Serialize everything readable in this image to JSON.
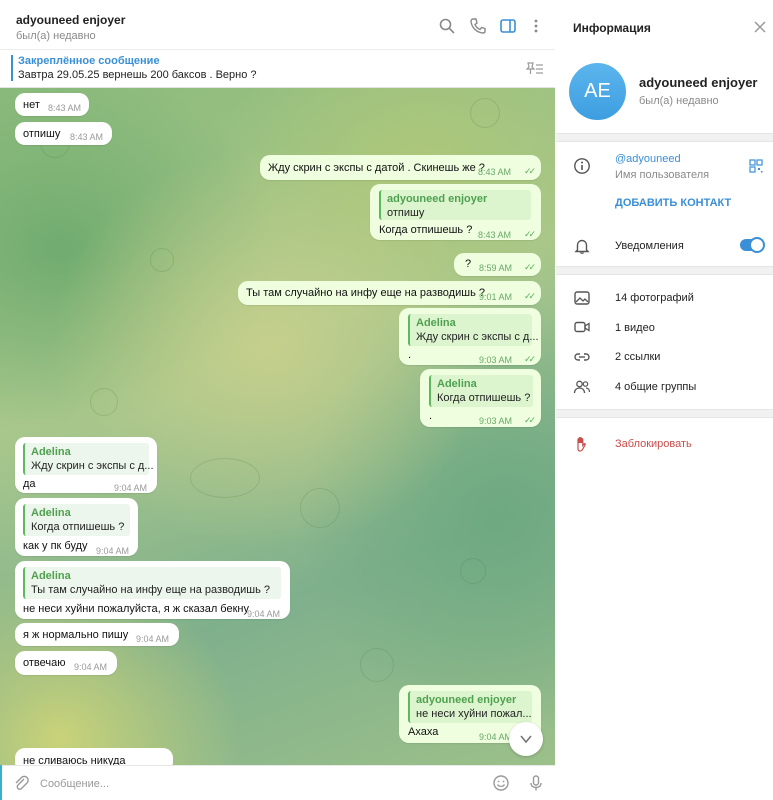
{
  "chat": {
    "title": "adyouneed enjoyer",
    "status": "был(а) недавно",
    "pinned_title": "Закреплённое сообщение",
    "pinned_text": "Завтра 29.05.25 вернешь 200 баксов . Верно ?",
    "composer_placeholder": "Сообщение..."
  },
  "messages": [
    {
      "dir": "in",
      "text": "нет",
      "time": "8:43 AM"
    },
    {
      "dir": "in",
      "text": "отпишу",
      "time": "8:43 AM"
    },
    {
      "dir": "out",
      "text": "Жду скрин с экспы с датой . Скинешь же ?",
      "time": "8:43 AM"
    },
    {
      "dir": "out",
      "reply_name": "adyouneed enjoyer",
      "reply_text": "отпишу",
      "text": "Когда отпишешь ?",
      "time": "8:43 AM"
    },
    {
      "dir": "out",
      "text": "?",
      "time": "8:59 AM"
    },
    {
      "dir": "out",
      "text": "Ты там случайно на инфу еще на разводишь ?",
      "time": "9:01 AM"
    },
    {
      "dir": "out",
      "reply_name": "Adelina",
      "reply_text": "Жду скрин с экспы с д...",
      "text": ".",
      "time": "9:03 AM"
    },
    {
      "dir": "out",
      "reply_name": "Adelina",
      "reply_text": "Когда отпишешь ?",
      "text": ".",
      "time": "9:03 AM"
    },
    {
      "dir": "in",
      "reply_name": "Adelina",
      "reply_text": "Жду скрин с экспы с д...",
      "text": "да",
      "time": "9:04 AM"
    },
    {
      "dir": "in",
      "reply_name": "Adelina",
      "reply_text": "Когда отпишешь ?",
      "text": "как у пк буду",
      "time": "9:04 AM"
    },
    {
      "dir": "in",
      "reply_name": "Adelina",
      "reply_text": "Ты там случайно на инфу еще на разводишь ?",
      "text": "не неси хуйни пожалуйста, я ж сказал бекну",
      "time": "9:04 AM"
    },
    {
      "dir": "in",
      "text": "я ж нормально пишу",
      "time": "9:04 AM"
    },
    {
      "dir": "in",
      "text": "отвечаю",
      "time": "9:04 AM"
    },
    {
      "dir": "out",
      "reply_name": "adyouneed enjoyer",
      "reply_text": "не неси хуйни пожал...",
      "text": "Ахаха",
      "time": "9:04 AM"
    },
    {
      "dir": "in",
      "text": "не сливаюсь никуда",
      "time": ""
    }
  ],
  "info": {
    "title": "Информация",
    "avatar_initials": "AE",
    "name": "adyouneed enjoyer",
    "status": "был(а) недавно",
    "username": "@adyouneed",
    "username_label": "Имя пользователя",
    "add_contact": "ДОБАВИТЬ КОНТАКТ",
    "notifications": "Уведомления",
    "notifications_on": true,
    "media": [
      {
        "icon": "photo-icon",
        "label": "14 фотографий"
      },
      {
        "icon": "video-icon",
        "label": "1 видео"
      },
      {
        "icon": "link-icon",
        "label": "2 ссылки"
      },
      {
        "icon": "groups-icon",
        "label": "4 общие группы"
      }
    ],
    "block": "Заблокировать"
  },
  "colors": {
    "accent": "#3a8fd6",
    "outgoing_bubble": "#eefedf",
    "reply_green": "#4fa14f",
    "danger": "#c94b4b"
  }
}
